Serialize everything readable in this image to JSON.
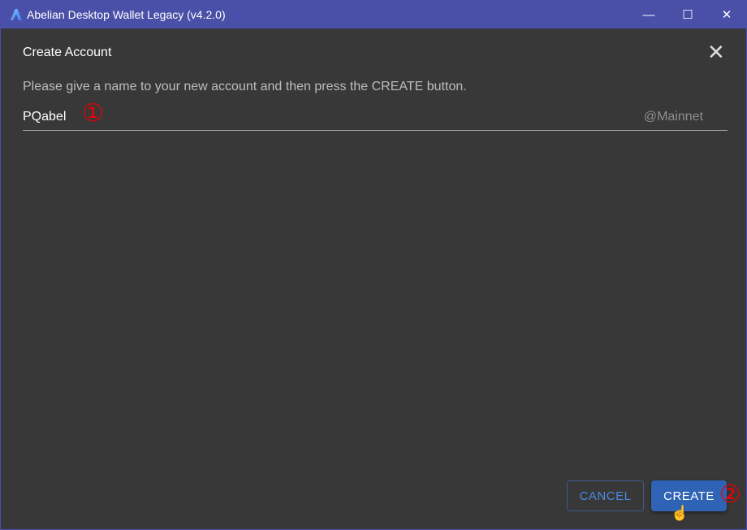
{
  "window": {
    "title": "Abelian Desktop Wallet Legacy (v4.2.0)",
    "minimize": "—",
    "maximize": "☐",
    "close": "✕"
  },
  "dialog": {
    "title": "Create Account",
    "close": "✕",
    "description": "Please give a name to your new account and then press the CREATE button.",
    "name_value": "PQabel",
    "suffix": "@Mainnet",
    "cancel_label": "CANCEL",
    "create_label": "CREATE"
  },
  "annotations": {
    "one": "①",
    "two": "②"
  },
  "colors": {
    "titlebar": "#4a50a8",
    "primary": "#2e63b5",
    "background": "#383838"
  }
}
